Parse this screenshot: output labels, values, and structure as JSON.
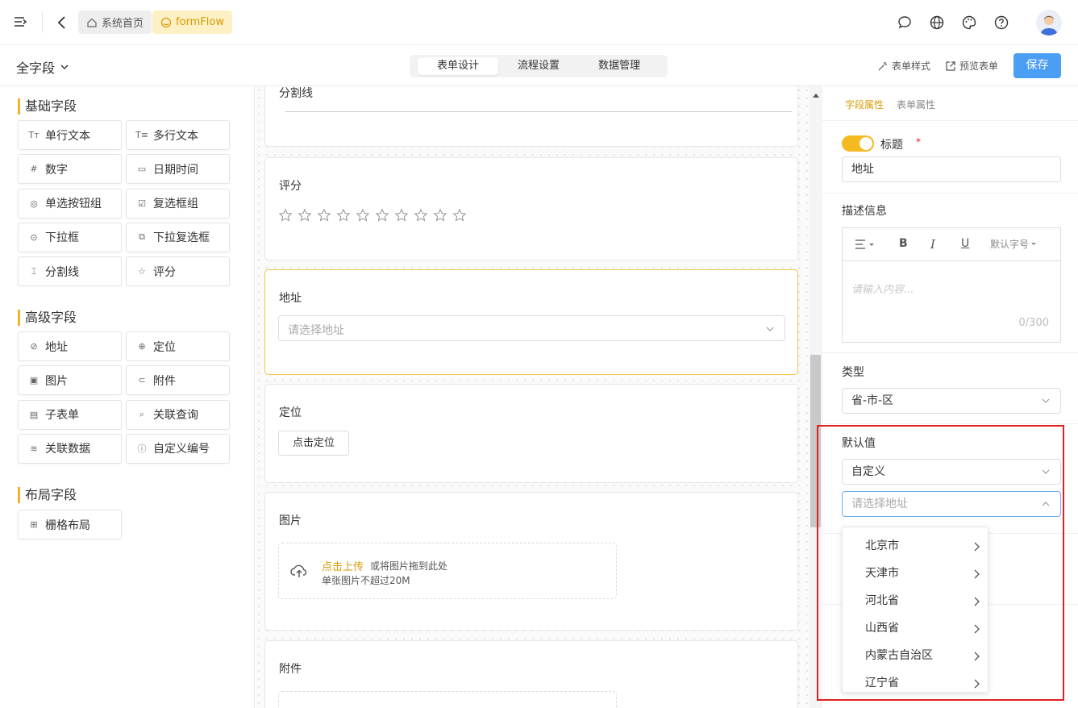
{
  "topbar": {
    "home_label": "系统首页",
    "app_label": "formFlow"
  },
  "subbar": {
    "form_name": "全字段",
    "tabs": [
      "表单设计",
      "流程设置",
      "数据管理"
    ],
    "form_style": "表单样式",
    "preview": "预览表单",
    "save": "保存"
  },
  "palette": {
    "basic_title": "基础字段",
    "basic": [
      "单行文本",
      "多行文本",
      "数字",
      "日期时间",
      "单选按钮组",
      "复选框组",
      "下拉框",
      "下拉复选框",
      "分割线",
      "评分"
    ],
    "basic_icons": [
      "Tт",
      "T≡",
      "#",
      "▭",
      "◎",
      "☑",
      "⊙",
      "⧉",
      "⌶",
      "☆"
    ],
    "advanced_title": "高级字段",
    "advanced": [
      "地址",
      "定位",
      "图片",
      "附件",
      "子表单",
      "关联查询",
      "关联数据",
      "自定义编号"
    ],
    "advanced_icons": [
      "⊘",
      "⊕",
      "▣",
      "⊂",
      "▤",
      "⌕",
      "≋",
      "ⓘ"
    ],
    "layout_title": "布局字段",
    "layout": [
      "栅格布局"
    ],
    "layout_icons": [
      "⊞"
    ]
  },
  "canvas": {
    "divider_label": "分割线",
    "rating_label": "评分",
    "address_label": "地址",
    "address_placeholder": "请选择地址",
    "location_label": "定位",
    "location_button": "点击定位",
    "image_label": "图片",
    "upload_link": "点击上传",
    "upload_text": "或将图片拖到此处",
    "upload_hint": "单张图片不超过20M",
    "attachment_label": "附件"
  },
  "props": {
    "tab_field": "字段属性",
    "tab_form": "表单属性",
    "title_label": "标题",
    "required_mark": "*",
    "title_value": "地址",
    "desc_label": "描述信息",
    "font_size": "默认字号",
    "editor_placeholder": "请输入内容...",
    "char_count": "0/300",
    "type_label": "类型",
    "type_value": "省-市-区",
    "default_label": "默认值",
    "default_mode": "自定义",
    "address_placeholder": "请选择地址",
    "provinces": [
      "北京市",
      "天津市",
      "河北省",
      "山西省",
      "内蒙古自治区",
      "辽宁省"
    ]
  },
  "colors": {
    "accent": "#f0b429",
    "primary": "#4a9ff5",
    "highlight_box": "#e02020"
  }
}
